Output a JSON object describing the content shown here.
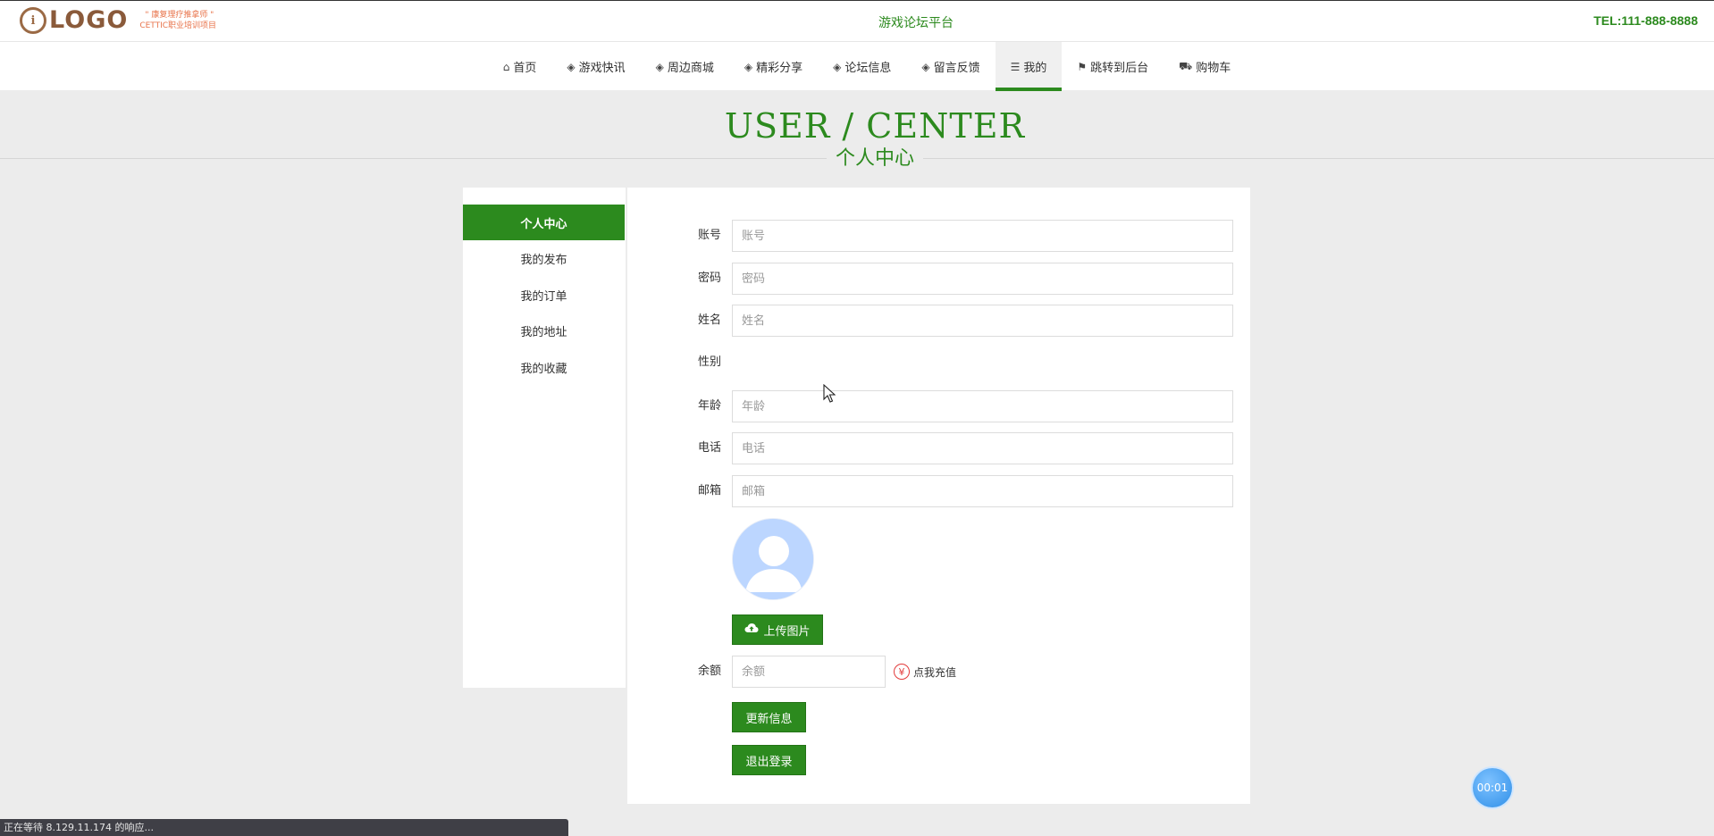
{
  "header": {
    "logo_text": "LOGO",
    "logo_sub1": "\" 康复理疗推拿师 \"",
    "logo_sub2": "CETTIC职业培训项目",
    "site_title": "游戏论坛平台",
    "tel": "TEL:111-888-8888"
  },
  "nav": {
    "items": [
      {
        "icon": "home-icon",
        "label": "首页"
      },
      {
        "icon": "cube-icon",
        "label": "游戏快讯"
      },
      {
        "icon": "cube-icon",
        "label": "周边商城"
      },
      {
        "icon": "cube-icon",
        "label": "精彩分享"
      },
      {
        "icon": "cube-icon",
        "label": "论坛信息"
      },
      {
        "icon": "cube-icon",
        "label": "留言反馈"
      },
      {
        "icon": "menu-icon",
        "label": "我的",
        "active": true
      },
      {
        "icon": "flag-icon",
        "label": "跳转到后台"
      },
      {
        "icon": "cart-icon",
        "label": "购物车"
      }
    ]
  },
  "heading": {
    "en": "USER / CENTER",
    "cn": "个人中心"
  },
  "sidebar": {
    "items": [
      {
        "label": "个人中心",
        "active": true
      },
      {
        "label": "我的发布"
      },
      {
        "label": "我的订单"
      },
      {
        "label": "我的地址"
      },
      {
        "label": "我的收藏"
      }
    ]
  },
  "form": {
    "account": {
      "label": "账号",
      "placeholder": "账号",
      "value": ""
    },
    "password": {
      "label": "密码",
      "placeholder": "密码",
      "value": ""
    },
    "name": {
      "label": "姓名",
      "placeholder": "姓名",
      "value": ""
    },
    "gender": {
      "label": "性别"
    },
    "age": {
      "label": "年龄",
      "placeholder": "年龄",
      "value": ""
    },
    "phone": {
      "label": "电话",
      "placeholder": "电话",
      "value": ""
    },
    "email": {
      "label": "邮箱",
      "placeholder": "邮箱",
      "value": ""
    },
    "upload_label": "上传图片",
    "balance": {
      "label": "余额",
      "placeholder": "余额",
      "value": ""
    },
    "recharge_label": "点我充值",
    "update_label": "更新信息",
    "logout_label": "退出登录"
  },
  "overlay": {
    "timer": "00:01",
    "status": "正在等待 8.129.11.174 的响应..."
  },
  "colors": {
    "accent": "#2c8a1e",
    "background": "#ececec",
    "avatar": "#bcd6ff"
  }
}
